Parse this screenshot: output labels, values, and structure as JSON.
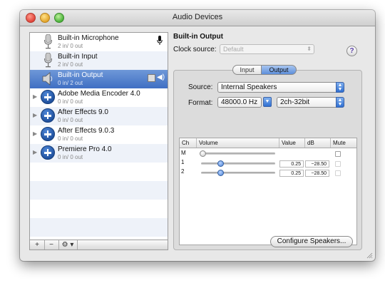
{
  "window": {
    "title": "Audio Devices"
  },
  "devices": [
    {
      "name": "Built-in Microphone",
      "io": "2 in/ 0 out",
      "icon": "microphone-icon"
    },
    {
      "name": "Built-in Input",
      "io": "2 in/ 0 out",
      "icon": "microphone-icon"
    },
    {
      "name": "Built-in Output",
      "io": "0 in/ 2 out",
      "icon": "speaker-icon",
      "selected": true
    },
    {
      "name": "Adobe Media Encoder 4.0",
      "io": "0 in/ 0 out",
      "icon": "aggregate-plus-icon"
    },
    {
      "name": "After Effects 9.0",
      "io": "0 in/ 0 out",
      "icon": "aggregate-plus-icon"
    },
    {
      "name": "After Effects 9.0.3",
      "io": "0 in/ 0 out",
      "icon": "aggregate-plus-icon"
    },
    {
      "name": "Premiere Pro 4.0",
      "io": "0 in/ 0 out",
      "icon": "aggregate-plus-icon"
    }
  ],
  "list_toolbar": {
    "add": "+",
    "remove": "−",
    "gear": "⚙ ▾"
  },
  "detail": {
    "device_title": "Built-in Output",
    "clock_label": "Clock source:",
    "clock_value": "Default",
    "help": "?",
    "tabs": [
      "Input",
      "Output"
    ],
    "active_tab": "Output",
    "source_label": "Source:",
    "source_value": "Internal Speakers",
    "format_label": "Format:",
    "format_rate": "48000.0 Hz",
    "format_channels": "2ch-32bit",
    "table_headers": [
      "Ch",
      "Volume",
      "Value",
      "dB",
      "Mute"
    ],
    "channels": [
      {
        "ch": "M",
        "value": "",
        "db": "",
        "volume": 0.0
      },
      {
        "ch": "1",
        "value": "0.25",
        "db": "−28.50",
        "volume": 0.25
      },
      {
        "ch": "2",
        "value": "0.25",
        "db": "−28.50",
        "volume": 0.25
      }
    ],
    "configure_button": "Configure Speakers..."
  },
  "colors": {
    "selection": "#4a78c8",
    "accent_blue": "#2f6fd1"
  }
}
